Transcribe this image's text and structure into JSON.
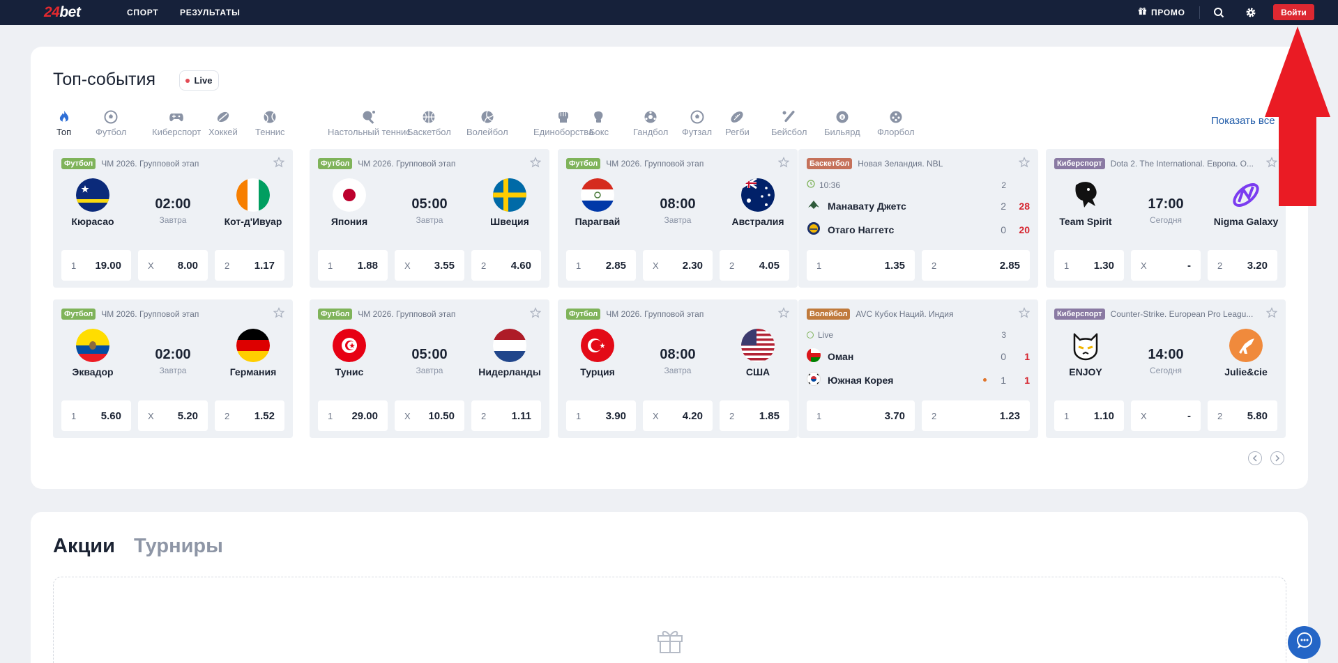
{
  "brand": {
    "logo_num": "24",
    "logo_text": "bet"
  },
  "topbar": {
    "nav": [
      "СПОРТ",
      "РЕЗУЛЬТАТЫ"
    ],
    "promo_label": "ПРОМО",
    "login_label": "Войти"
  },
  "top_events": {
    "title": "Топ-события",
    "live_label": "Live",
    "show_all": "Показать все",
    "sport_tabs": [
      "Топ",
      "Футбол",
      "Киберспорт",
      "Хоккей",
      "Теннис",
      "Настольный теннис",
      "Баскетбол",
      "Волейбол",
      "Единоборства",
      "Бокс",
      "Гандбол",
      "Футзал",
      "Регби",
      "Бейсбол",
      "Бильярд",
      "Флорбол"
    ],
    "active_tab": "Топ"
  },
  "cards": [
    {
      "sport": "Футбол",
      "tag_color": "#7fb35a",
      "league": "ЧМ 2026. Групповой этап",
      "team1": "Кюрасао",
      "team2": "Кот-д'Ивуар",
      "time": "02:00",
      "day": "Завтра",
      "odds": [
        [
          "1",
          "19.00"
        ],
        [
          "X",
          "8.00"
        ],
        [
          "2",
          "1.17"
        ]
      ]
    },
    {
      "sport": "Футбол",
      "tag_color": "#7fb35a",
      "league": "ЧМ 2026. Групповой этап",
      "team1": "Япония",
      "team2": "Швеция",
      "time": "05:00",
      "day": "Завтра",
      "odds": [
        [
          "1",
          "1.88"
        ],
        [
          "X",
          "3.55"
        ],
        [
          "2",
          "4.60"
        ]
      ]
    },
    {
      "sport": "Футбол",
      "tag_color": "#7fb35a",
      "league": "ЧМ 2026. Групповой этап",
      "team1": "Парагвай",
      "team2": "Австралия",
      "time": "08:00",
      "day": "Завтра",
      "odds": [
        [
          "1",
          "2.85"
        ],
        [
          "X",
          "2.30"
        ],
        [
          "2",
          "4.05"
        ]
      ]
    },
    {
      "sport": "Баскетбол",
      "tag_color": "#c5715a",
      "league": "Новая Зеландия. NBL",
      "status": "10:36",
      "period": "2",
      "team1": "Манавату Джетс",
      "team2": "Отаго Наггетс",
      "score1": [
        "2",
        "28"
      ],
      "score2": [
        "0",
        "20"
      ],
      "odds": [
        [
          "1",
          "1.35"
        ],
        [
          "2",
          "2.85"
        ]
      ]
    },
    {
      "sport": "Киберспорт",
      "tag_color": "#8a7aa3",
      "league": "Dota 2. The International. Европа. О...",
      "team1": "Team Spirit",
      "team2": "Nigma Galaxy",
      "time": "17:00",
      "day": "Сегодня",
      "odds": [
        [
          "1",
          "1.30"
        ],
        [
          "X",
          "-"
        ],
        [
          "2",
          "3.20"
        ]
      ]
    },
    {
      "sport": "Футбол",
      "tag_color": "#7fb35a",
      "league": "ЧМ 2026. Групповой этап",
      "team1": "Эквадор",
      "team2": "Германия",
      "time": "02:00",
      "day": "Завтра",
      "odds": [
        [
          "1",
          "5.60"
        ],
        [
          "X",
          "5.20"
        ],
        [
          "2",
          "1.52"
        ]
      ]
    },
    {
      "sport": "Футбол",
      "tag_color": "#7fb35a",
      "league": "ЧМ 2026. Групповой этап",
      "team1": "Тунис",
      "team2": "Нидерланды",
      "time": "05:00",
      "day": "Завтра",
      "odds": [
        [
          "1",
          "29.00"
        ],
        [
          "X",
          "10.50"
        ],
        [
          "2",
          "1.11"
        ]
      ]
    },
    {
      "sport": "Футбол",
      "tag_color": "#7fb35a",
      "league": "ЧМ 2026. Групповой этап",
      "team1": "Турция",
      "team2": "США",
      "time": "08:00",
      "day": "Завтра",
      "odds": [
        [
          "1",
          "3.90"
        ],
        [
          "X",
          "4.20"
        ],
        [
          "2",
          "1.85"
        ]
      ]
    },
    {
      "sport": "Волейбол",
      "tag_color": "#c07a3c",
      "league": "AVC Кубок Наций. Индия",
      "status": "Live",
      "period": "3",
      "team1": "Оман",
      "team2": "Южная Корея",
      "score1": [
        "0",
        "1"
      ],
      "score2": [
        "1",
        "1"
      ],
      "odds": [
        [
          "1",
          "3.70"
        ],
        [
          "2",
          "1.23"
        ]
      ]
    },
    {
      "sport": "Киберспорт",
      "tag_color": "#8a7aa3",
      "league": "Counter-Strike. European Pro Leagu...",
      "team1": "ENJOY",
      "team2": "Julie&cie",
      "time": "14:00",
      "day": "Сегодня",
      "odds": [
        [
          "1",
          "1.10"
        ],
        [
          "X",
          "-"
        ],
        [
          "2",
          "5.80"
        ]
      ]
    }
  ],
  "promo_section": {
    "tab_active": "Акции",
    "tab_inactive": "Турниры"
  }
}
